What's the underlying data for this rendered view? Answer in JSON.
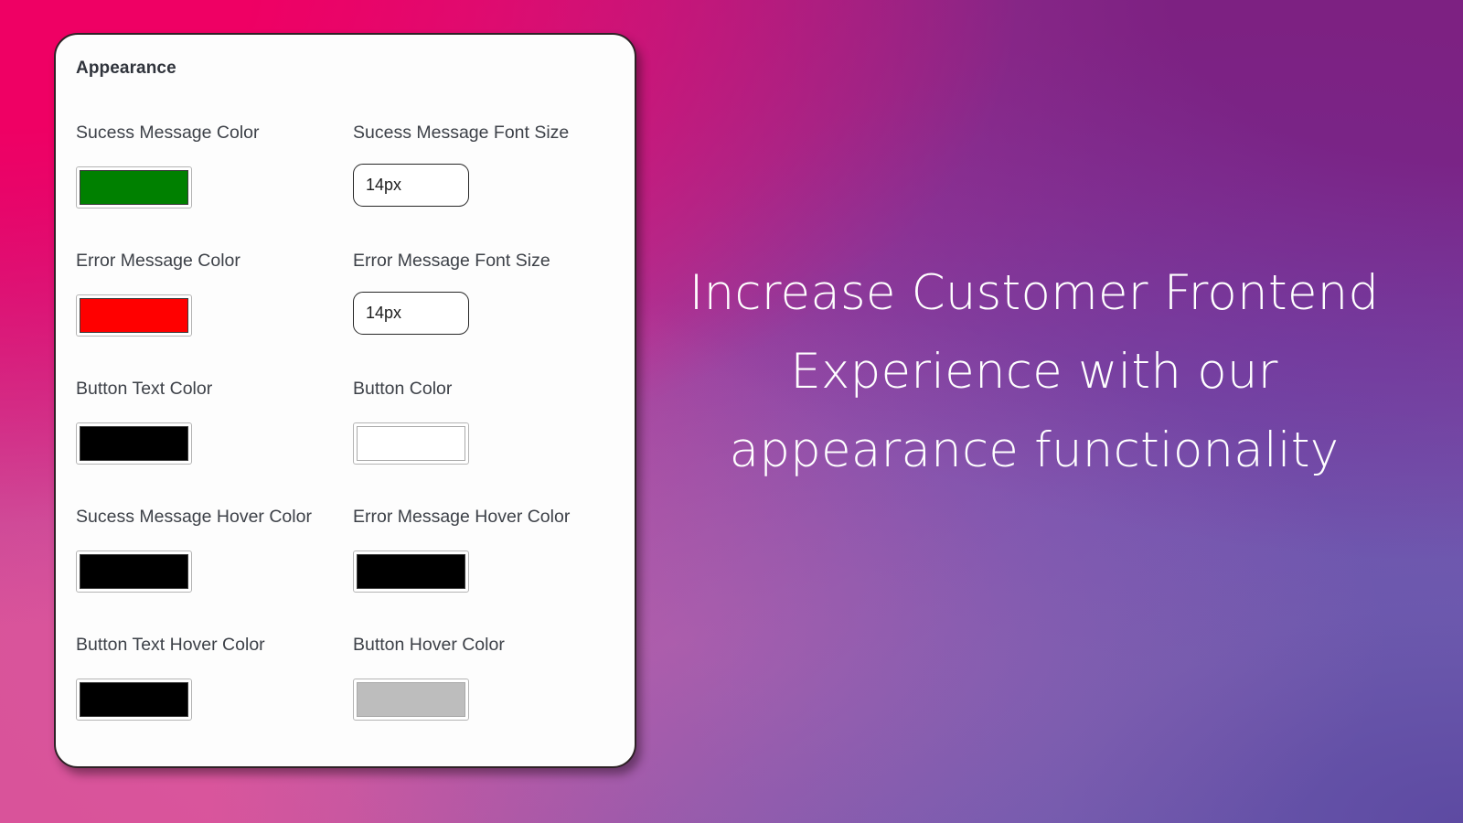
{
  "card": {
    "title": "Appearance",
    "fields": [
      {
        "label": "Sucess Message Color",
        "control": "color",
        "value": "#008000",
        "name": "success-message-color"
      },
      {
        "label": "Sucess Message Font Size",
        "control": "text",
        "value": "14px",
        "placeholder": "14px",
        "name": "success-message-font-size"
      },
      {
        "label": "Error Message Color",
        "control": "color",
        "value": "#ff0000",
        "name": "error-message-color"
      },
      {
        "label": "Error Message Font Size",
        "control": "text",
        "value": "14px",
        "placeholder": "14px",
        "name": "error-message-font-size"
      },
      {
        "label": "Button Text Color",
        "control": "color",
        "value": "#000000",
        "name": "button-text-color"
      },
      {
        "label": "Button Color",
        "control": "color",
        "value": "#ffffff",
        "name": "button-color"
      },
      {
        "label": "Sucess Message Hover Color",
        "control": "color",
        "value": "#000000",
        "name": "success-message-hover-color"
      },
      {
        "label": "Error Message Hover Color",
        "control": "color",
        "value": "#000000",
        "name": "error-message-hover-color"
      },
      {
        "label": "Button Text Hover Color",
        "control": "color",
        "value": "#000000",
        "name": "button-text-hover-color"
      },
      {
        "label": "Button Hover Color",
        "control": "color",
        "value": "#bdbdbd",
        "name": "button-hover-color"
      }
    ]
  },
  "headline": {
    "text": "Increase Customer Frontend Experience with our appearance functionality"
  },
  "theme": {
    "background_top_left": "#ef0064",
    "background_top_right": "#7d2182",
    "background_bottom_left": "#d9539a",
    "background_bottom_right": "#5d4aa2",
    "card_background": "#fdfdfd",
    "card_border": "#2d2125",
    "label_color": "#3d4148",
    "headline_color": "#ffffff"
  }
}
